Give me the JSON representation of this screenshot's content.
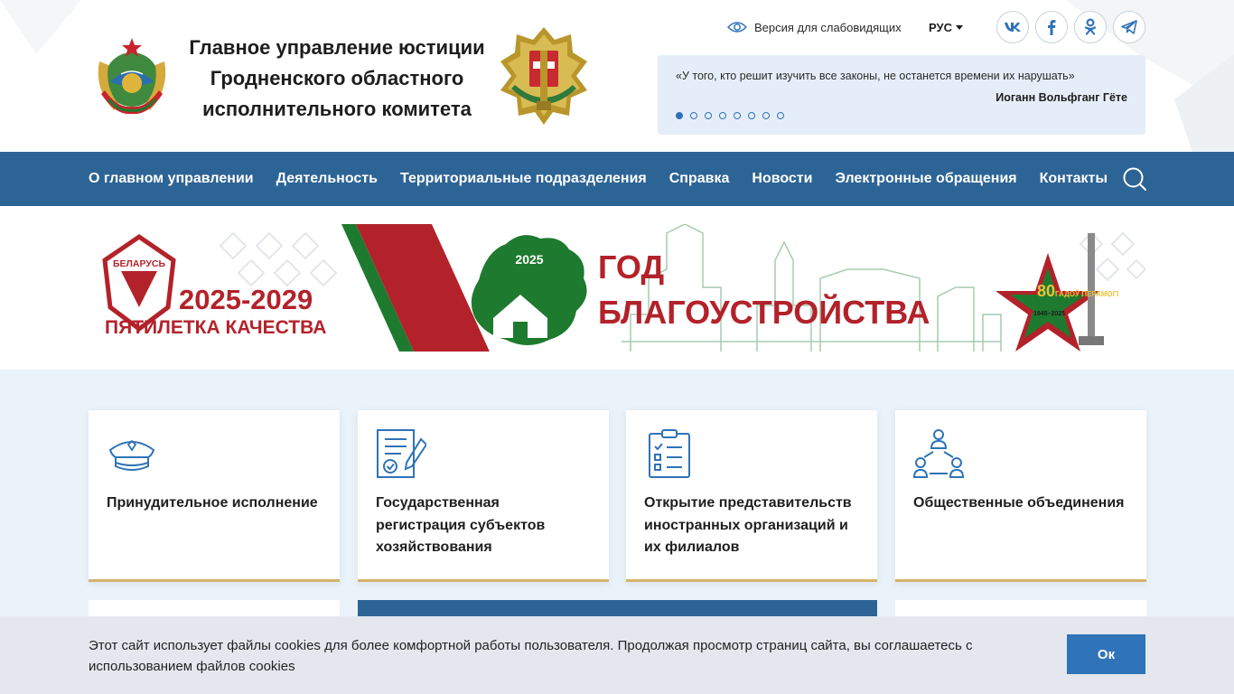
{
  "header": {
    "title_lines": [
      "Главное управление юстиции",
      "Гродненского областного",
      "исполнительного комитета"
    ],
    "accessibility_label": "Версия для слабовидящих",
    "language": "РУС",
    "social": [
      {
        "name": "vk",
        "icon": "vk-icon",
        "glyph": "vk"
      },
      {
        "name": "facebook",
        "icon": "facebook-icon",
        "glyph": "f"
      },
      {
        "name": "odnoklassniki",
        "icon": "odnoklassniki-icon",
        "glyph": "ok"
      },
      {
        "name": "telegram",
        "icon": "telegram-icon",
        "glyph": "tg"
      }
    ]
  },
  "quote": {
    "text": "«У того, кто решит изучить все законы, не останется времени их нарушать»",
    "author": "Иоганн Вольфганг Гёте",
    "slides": 8,
    "active_slide": 1
  },
  "nav": {
    "items": [
      "О главном управлении",
      "Деятельность",
      "Территориальные подразделения",
      "Справка",
      "Новости",
      "Электронные обращения",
      "Контакты"
    ]
  },
  "banner": {
    "badge_country": "БЕЛАРУСЬ",
    "years": "2025-2029",
    "subtitle": "ПЯТИЛЕТКА КАЧЕСТВА",
    "map_year": "2025",
    "year_word": "ГОД",
    "year_theme": "БЛАГОУСТРОЙСТВА",
    "victory_top": "80",
    "victory_text": "ГАДОЎ ПЕРАМОГІ",
    "victory_years": "1945–2025"
  },
  "cards": [
    {
      "title": "Принудительное исполнение",
      "icon": "police-cap-icon"
    },
    {
      "title": "Государственная регистрация субъектов хозяйствования",
      "icon": "document-sign-icon"
    },
    {
      "title": "Открытие представительств иностранных организаций и их филиалов",
      "icon": "checklist-icon"
    },
    {
      "title": "Общественные объединения",
      "icon": "people-network-icon"
    }
  ],
  "cookie": {
    "text": "Этот сайт использует файлы cookies для более комфортной работы пользователя. Продолжая просмотр страниц сайта, вы соглашаетесь с использованием файлов cookies",
    "button": "Ок"
  },
  "colors": {
    "nav": "#2d6496",
    "accent": "#2f73b8",
    "card_border": "#d6b26e",
    "content_bg": "#eaf2fa",
    "banner_red": "#b3222a",
    "banner_green": "#1e7a2e"
  }
}
